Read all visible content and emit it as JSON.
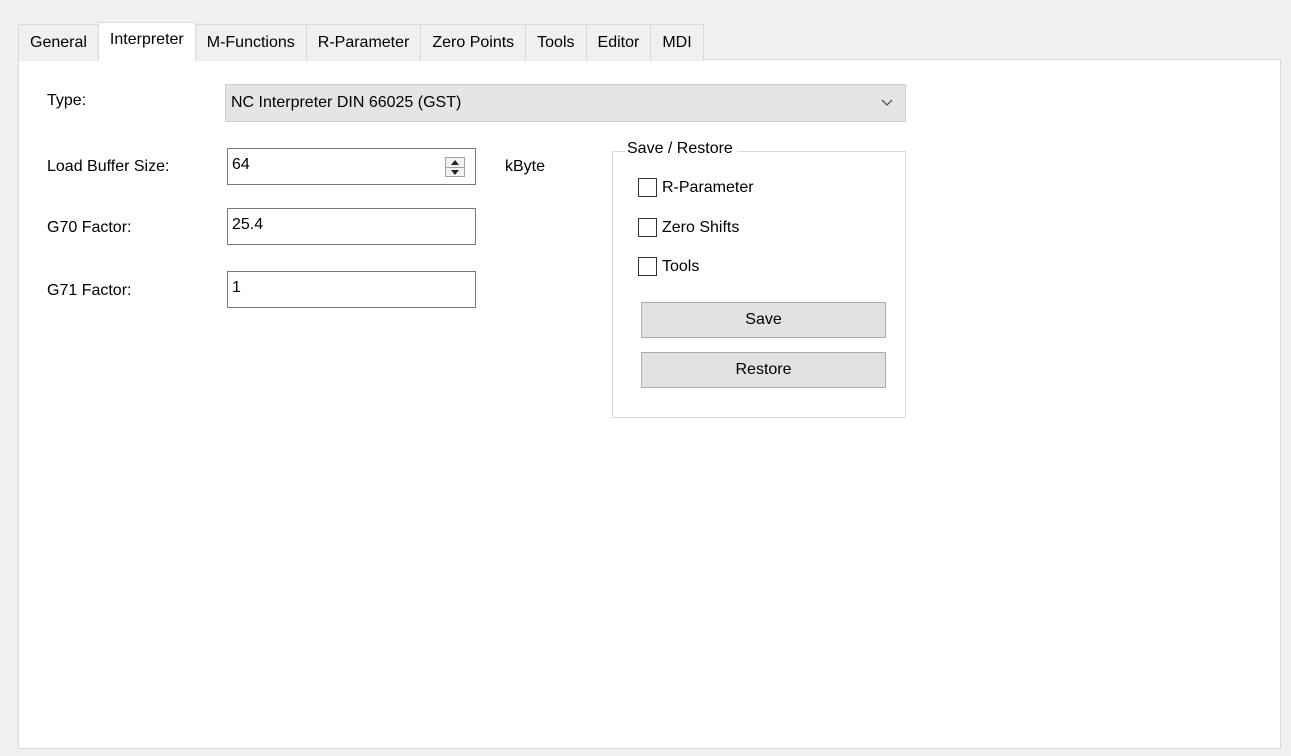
{
  "tabs": [
    {
      "label": "General",
      "active": false
    },
    {
      "label": "Interpreter",
      "active": true
    },
    {
      "label": "M-Functions",
      "active": false
    },
    {
      "label": "R-Parameter",
      "active": false
    },
    {
      "label": "Zero Points",
      "active": false
    },
    {
      "label": "Tools",
      "active": false
    },
    {
      "label": "Editor",
      "active": false
    },
    {
      "label": "MDI",
      "active": false
    }
  ],
  "form": {
    "type_label": "Type:",
    "type_value": "NC Interpreter DIN 66025 (GST)",
    "buffer_label": "Load Buffer Size:",
    "buffer_value": "64",
    "buffer_unit": "kByte",
    "g70_label": "G70 Factor:",
    "g70_value": "25.4",
    "g71_label": "G71 Factor:",
    "g71_value": "1"
  },
  "save_restore": {
    "title": "Save / Restore",
    "options": [
      {
        "label": "R-Parameter",
        "checked": false
      },
      {
        "label": "Zero Shifts",
        "checked": false
      },
      {
        "label": "Tools",
        "checked": false
      }
    ],
    "save_label": "Save",
    "restore_label": "Restore"
  },
  "icons": {
    "combo_arrow": "chevron-down-icon",
    "spin_up": "spin-up-icon",
    "spin_down": "spin-down-icon"
  }
}
